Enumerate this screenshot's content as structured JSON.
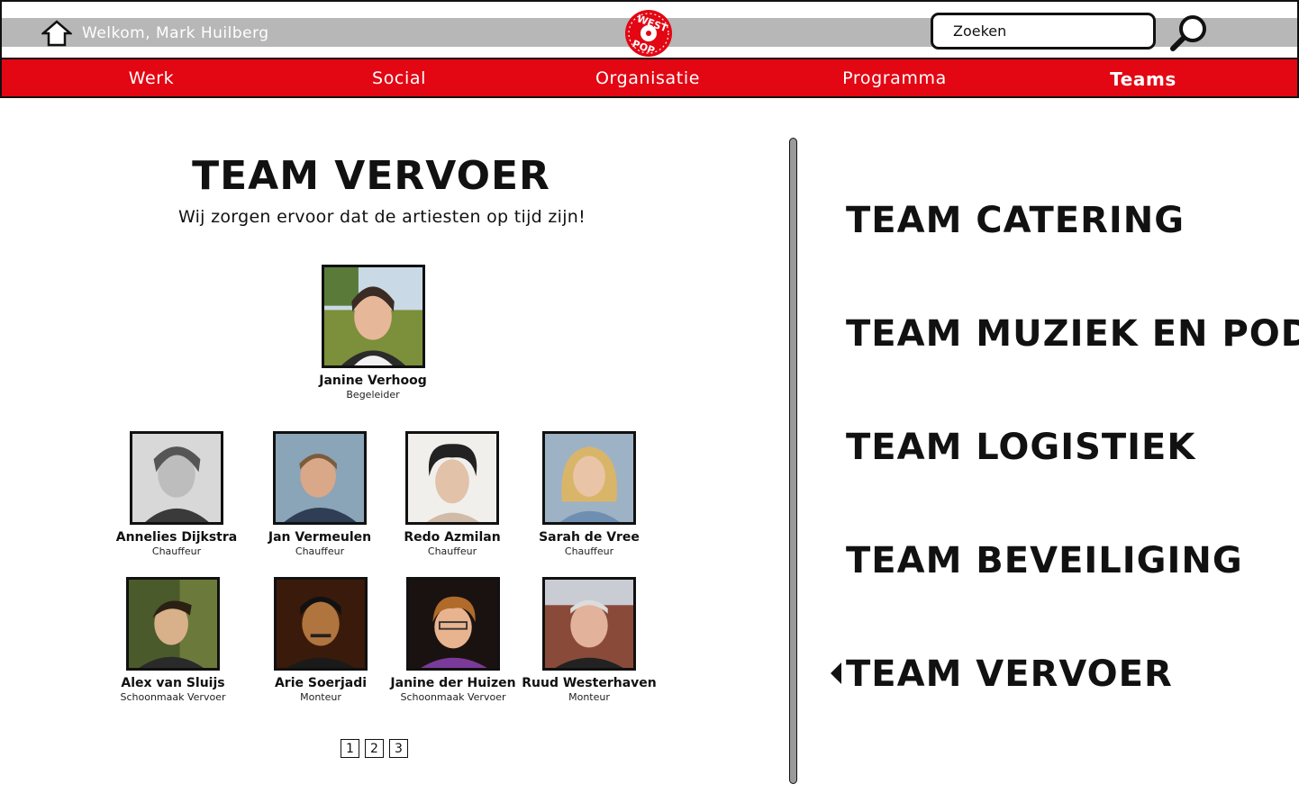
{
  "header": {
    "welcome_text": "Welkom, Mark Huilberg",
    "logo_text": "WEST POP",
    "search": {
      "placeholder": "Zoeken"
    }
  },
  "nav": {
    "items": [
      {
        "label": "Werk"
      },
      {
        "label": "Social"
      },
      {
        "label": "Organisatie"
      },
      {
        "label": "Programma"
      },
      {
        "label": "Teams"
      }
    ],
    "active": "Teams"
  },
  "team": {
    "title": "TEAM VERVOER",
    "subtitle": "Wij zorgen ervoor dat de artiesten op tijd zijn!",
    "leader": {
      "name": "Janine Verhoog",
      "role": "Begeleider"
    },
    "members": [
      {
        "name": "Annelies Dijkstra",
        "role": "Chauffeur"
      },
      {
        "name": "Jan Vermeulen",
        "role": "Chauffeur"
      },
      {
        "name": "Redo Azmilan",
        "role": "Chauffeur"
      },
      {
        "name": "Sarah de Vree",
        "role": "Chauffeur"
      },
      {
        "name": "Alex van Sluijs",
        "role": "Schoonmaak Vervoer"
      },
      {
        "name": "Arie Soerjadi",
        "role": "Monteur"
      },
      {
        "name": "Janine der Huizen",
        "role": "Schoonmaak Vervoer"
      },
      {
        "name": "Ruud Westerhaven",
        "role": "Monteur"
      }
    ],
    "pages": [
      "1",
      "2",
      "3"
    ]
  },
  "teams_list": [
    {
      "label": "TEAM CATERING"
    },
    {
      "label": "TEAM MUZIEK EN PODIA"
    },
    {
      "label": "TEAM LOGISTIEK"
    },
    {
      "label": "TEAM BEVEILIGING"
    },
    {
      "label": "TEAM VERVOER"
    }
  ],
  "colors": {
    "accent_red": "#e30613",
    "header_grey": "#b7b7b7"
  }
}
